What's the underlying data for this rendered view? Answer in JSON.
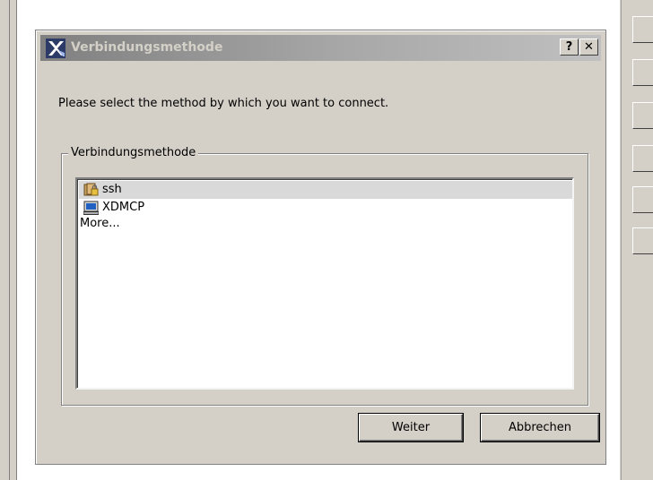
{
  "dialog": {
    "title": "Verbindungsmethode",
    "title_icon": "x2go-logo-icon",
    "help_label": "?",
    "close_label": "✕",
    "prompt": "Please select the method by which you want to connect.",
    "group_label": "Verbindungsmethode",
    "methods": [
      {
        "label": "ssh",
        "icon": "ssh-keys-icon",
        "selected": true
      },
      {
        "label": "XDMCP",
        "icon": "monitor-icon",
        "selected": false
      },
      {
        "label": "More...",
        "icon": "",
        "selected": false
      }
    ],
    "next_label": "Weiter",
    "cancel_label": "Abbrechen"
  },
  "colors": {
    "face": "#d4d0c8",
    "titlebar_start": "#808080",
    "titlebar_end": "#c0c0c0",
    "selection": "#d9d9d9"
  }
}
